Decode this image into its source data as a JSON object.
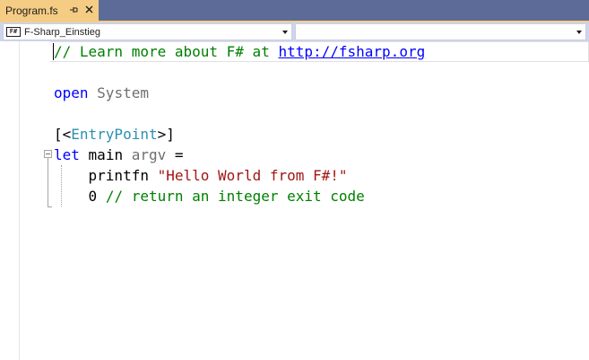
{
  "tab": {
    "title": "Program.fs",
    "pin_icon": "pin-icon",
    "close_icon": "close-icon"
  },
  "navbar": {
    "left_badge": "F#",
    "left_value": "F-Sharp_Einstieg",
    "right_value": ""
  },
  "code": {
    "line1": {
      "comment": "// Learn more about F# at ",
      "link": "http://fsharp.org"
    },
    "line3": {
      "keyword": "open",
      "space": " ",
      "module": "System"
    },
    "line5": {
      "open": "[<",
      "attr": "EntryPoint",
      "close": ">]"
    },
    "line6": {
      "keyword": "let",
      "sp1": " ",
      "name": "main",
      "sp2": " ",
      "param": "argv",
      "rest": " ="
    },
    "line7": {
      "indent": "    ",
      "fn": "printfn",
      "sp": " ",
      "string": "\"Hello World from F#!\""
    },
    "line8": {
      "indent": "    ",
      "number": "0",
      "sp": " ",
      "comment": "// return an integer exit code"
    }
  },
  "colors": {
    "tab_active": "#f5cc84",
    "tabstrip": "#5d6b99",
    "keyword": "#0000ff",
    "comment": "#008000",
    "type": "#2b91af",
    "string": "#a31515"
  }
}
